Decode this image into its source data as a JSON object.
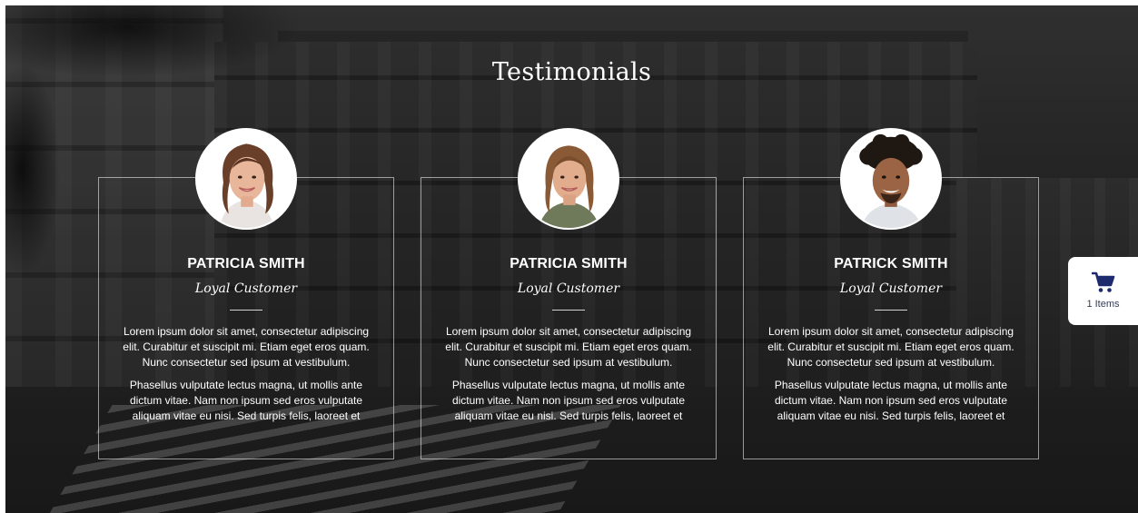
{
  "section": {
    "title": "Testimonials"
  },
  "testimonials": [
    {
      "name": "PATRICIA SMITH",
      "role": "Loyal Customer",
      "paragraph1": "Lorem ipsum dolor sit amet, consectetur adipiscing elit. Curabitur et suscipit mi. Etiam eget eros quam. Nunc consectetur sed ipsum at vestibulum.",
      "paragraph2": "Phasellus vulputate lectus magna, ut mollis ante dictum vitae. Nam non ipsum sed eros vulputate aliquam vitae eu nisi. Sed turpis felis, laoreet et"
    },
    {
      "name": "PATRICIA SMITH",
      "role": "Loyal Customer",
      "paragraph1": "Lorem ipsum dolor sit amet, consectetur adipiscing elit. Curabitur et suscipit mi. Etiam eget eros quam. Nunc consectetur sed ipsum at vestibulum.",
      "paragraph2": "Phasellus vulputate lectus magna, ut mollis ante dictum vitae. Nam non ipsum sed eros vulputate aliquam vitae eu nisi. Sed turpis felis, laoreet et"
    },
    {
      "name": "PATRICK SMITH",
      "role": "Loyal Customer",
      "paragraph1": "Lorem ipsum dolor sit amet, consectetur adipiscing elit. Curabitur et suscipit mi. Etiam eget eros quam. Nunc consectetur sed ipsum at vestibulum.",
      "paragraph2": "Phasellus vulputate lectus magna, ut mollis ante dictum vitae. Nam non ipsum sed eros vulputate aliquam vitae eu nisi. Sed turpis felis, laoreet et"
    }
  ],
  "cart": {
    "icon": "shopping-cart-icon",
    "count_label": "1 Items",
    "icon_color": "#1e2a6e"
  },
  "colors": {
    "text": "#ffffff",
    "card_border": "#d9d9d9",
    "cart_text": "#333c58"
  }
}
